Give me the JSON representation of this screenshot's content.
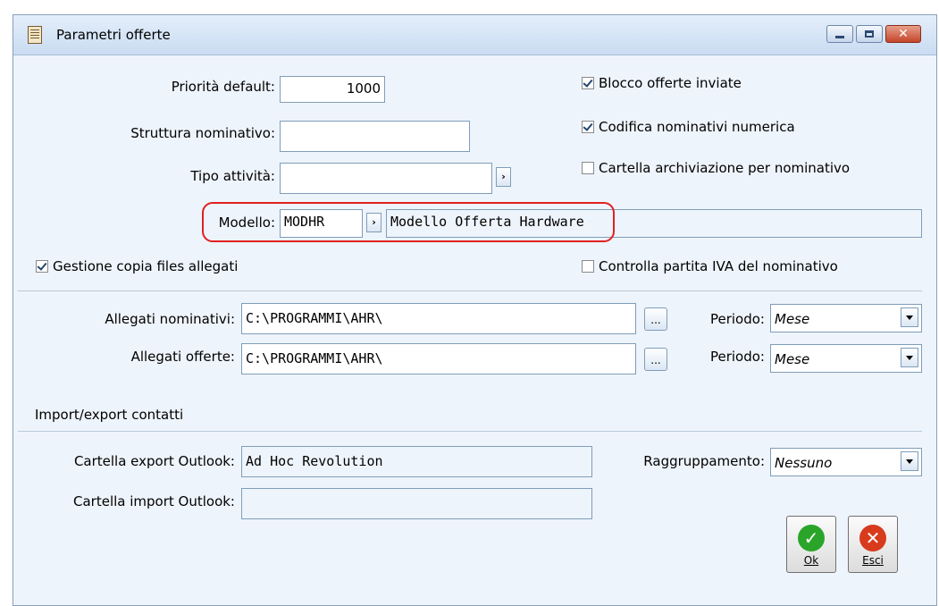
{
  "window": {
    "title": "Parametri offerte"
  },
  "fields": {
    "priorita_default": {
      "label": "Priorità default:",
      "value": "1000"
    },
    "struttura_nominativo": {
      "label": "Struttura nominativo:",
      "value": ""
    },
    "tipo_attivita": {
      "label": "Tipo attività:",
      "value": "",
      "lookup_glyph": "›"
    },
    "modello": {
      "label": "Modello:",
      "code": "MODHR",
      "description": "Modello Offerta Hardware",
      "lookup_glyph": "›"
    }
  },
  "checkboxes": {
    "blocco_offerte": {
      "label": "Blocco offerte inviate",
      "checked": true
    },
    "codifica_numerica": {
      "label": "Codifica nominativi numerica",
      "checked": true
    },
    "cartella_archiviazione": {
      "label": "Cartella archiviazione per nominativo",
      "checked": false
    },
    "gestione_copia": {
      "label": "Gestione copia files allegati",
      "checked": true
    },
    "controlla_iva": {
      "label": "Controlla partita IVA del nominativo",
      "checked": false
    }
  },
  "allegati": {
    "nominativi": {
      "label": "Allegati nominativi:",
      "value": "C:\\PROGRAMMI\\AHR\\",
      "browse": "...",
      "periodo_label": "Periodo:",
      "periodo_value": "Mese"
    },
    "offerte": {
      "label": "Allegati offerte:",
      "value": "C:\\PROGRAMMI\\AHR\\",
      "browse": "...",
      "periodo_label": "Periodo:",
      "periodo_value": "Mese"
    }
  },
  "import_export": {
    "section_title": "Import/export contatti",
    "export_label": "Cartella export Outlook:",
    "export_value": "Ad Hoc Revolution",
    "import_label": "Cartella import Outlook:",
    "import_value": "",
    "raggruppamento_label": "Raggruppamento:",
    "raggruppamento_value": "Nessuno"
  },
  "buttons": {
    "ok": {
      "label": "Ok",
      "glyph": "✓",
      "color": "#2aa52a"
    },
    "esci": {
      "label": "Esci",
      "glyph": "✕",
      "color": "#d83a1c"
    }
  },
  "icons": {
    "window_icon": "document-icon",
    "minimize": "minimize-icon",
    "maximize": "maximize-icon",
    "close": "close-icon"
  }
}
